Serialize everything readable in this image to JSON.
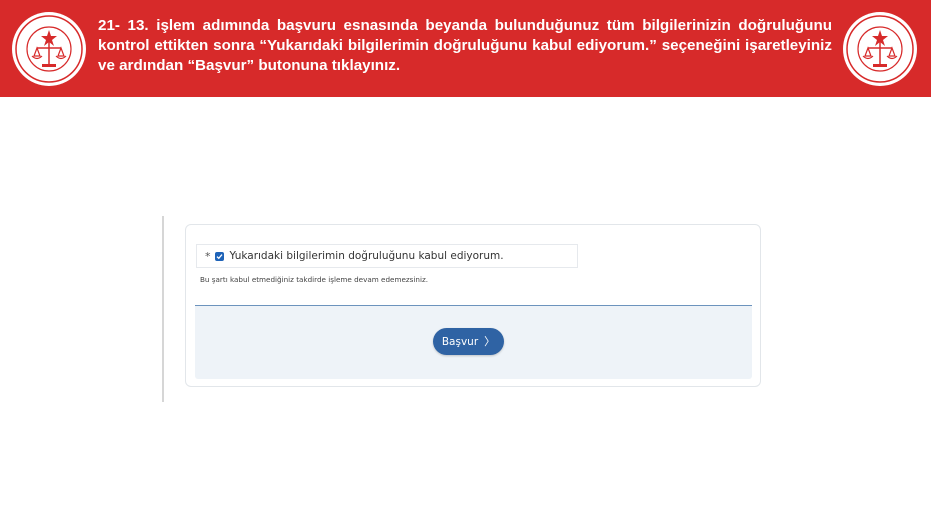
{
  "banner": {
    "instruction": "21- 13. işlem adımında başvuru esnasında beyanda bulunduğunuz tüm bilgilerinizin doğruluğunu kontrol ettikten sonra “Yukarıdaki bilgilerimin doğruluğunu kabul ediyorum.” seçeneğini işaretleyiniz ve ardından “Başvur” butonuna tıklayınız.",
    "color": "#d72a2a",
    "seal_icon": "ministry-seal-icon"
  },
  "form": {
    "required_marker": "*",
    "checkbox_checked": true,
    "checkbox_label": "Yukarıdaki bilgilerimin doğruluğunu kabul ediyorum.",
    "hint": "Bu şartı kabul etmediğiniz takdirde işleme devam edemezsiniz.",
    "submit_label": "Başvur",
    "submit_icon": "chevron-right-icon",
    "accent": "#2f63a4"
  }
}
